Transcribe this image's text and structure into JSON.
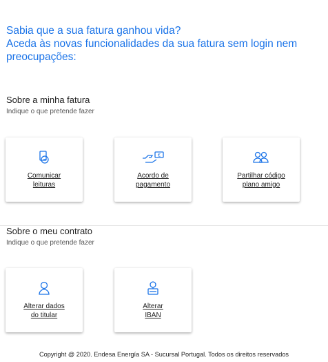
{
  "intro": {
    "line1": "Sabia que a sua fatura ganhou vida?",
    "line2": "Aceda às novas funcionalidades da sua fatura sem login nem preocupações:"
  },
  "invoice_section": {
    "title": "Sobre a minha fatura",
    "subtitle": "Indique o que pretende fazer",
    "cards": [
      {
        "icon": "meter-reading-icon",
        "line1": "Comunicar",
        "line2": "leituras"
      },
      {
        "icon": "payment-agreement-icon",
        "line1": "Acordo de",
        "line2": "pagamento"
      },
      {
        "icon": "share-users-icon",
        "line1": "Partilhar código",
        "line2": "plano amigo"
      }
    ]
  },
  "contract_section": {
    "title": "Sobre o meu contrato",
    "subtitle": "Indique o que pretende fazer",
    "cards": [
      {
        "icon": "user-icon",
        "line1": "Alterar dados",
        "line2": "do titular"
      },
      {
        "icon": "bank-iban-icon",
        "line1": "Alterar",
        "line2": "IBAN"
      }
    ]
  },
  "footer": {
    "text": "Copyright @ 2020. Endesa Energía SA - Sucursal Portugal. Todos os direitos reservados"
  },
  "colors": {
    "accent": "#1a73e8",
    "text": "#222222"
  }
}
